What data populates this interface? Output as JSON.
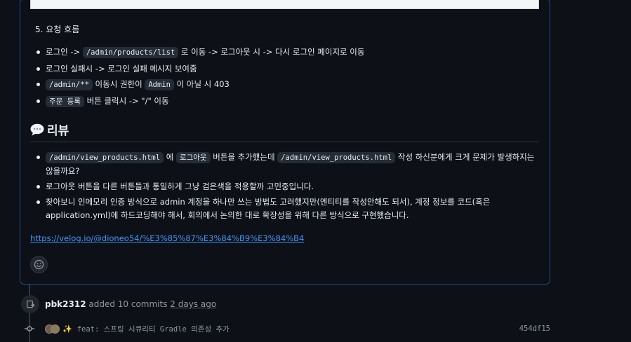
{
  "comment": {
    "section_heading": "5. 요청 흐름",
    "flow_items": [
      {
        "pre": "로그인 -> ",
        "code": "/admin/products/list",
        "post": " 로 이동 -> 로그아웃 시 -> 다시 로그인 페이지로 이동"
      },
      {
        "pre": "로그인 실패시 -> 로그인 실패 메시지 보여줌",
        "code": "",
        "post": ""
      },
      {
        "pre": "",
        "code": "/admin/**",
        "post": " 이동시 권한이 ",
        "code2": "Admin",
        "post2": " 이 아닐 시 403"
      },
      {
        "pre": "",
        "code": "주문 등록",
        "post": " 버튼 클릭시 -> \"/\" 이동"
      }
    ],
    "review_heading": "리뷰",
    "review_icon": "speech-balloon-icon",
    "review_items": [
      {
        "code1": "/admin/view_products.html",
        "t1": " 에 ",
        "code2": "로그아웃",
        "t2": " 버튼을 추가했는데 ",
        "code3": "/admin/view_products.html",
        "t3": " 작성 하신분에게 크게 문제가 발생하지는 않을까요?"
      },
      {
        "text": "로그아웃 버튼을 다른 버튼들과 통일하게 그냥 검은색을 적용할까 고민중입니다."
      },
      {
        "text": "찾아보니 인메모리 인증 방식으로 admin 계정을 하나만 쓰는 방법도 고려했지만(엔티티를 작성안해도 되서), 계정 정보를 코드(혹은 application.yml)에 하드코딩해야 해서, 회의에서 논의한 대로 확장성을 위해 다른 방식으로 구현했습니다."
      }
    ],
    "link_text": "https://velog.io/@dioneo54/%E3%85%87%E3%84%B9%E3%84%B4",
    "emoji_button_icon": "smiley-icon"
  },
  "event": {
    "icon": "repo-push-icon",
    "user": "pbk2312",
    "action": " added 10 commits ",
    "time": "2 days ago"
  },
  "commit": {
    "icon": "git-commit-icon",
    "sparkle": "✨",
    "message": "feat: 스프링 시큐리티 Gradle 의존성 추가",
    "sha": "454df15"
  },
  "colors": {
    "background": "#0d1117",
    "link": "#4493f8",
    "border_active": "#1f4a8a"
  }
}
